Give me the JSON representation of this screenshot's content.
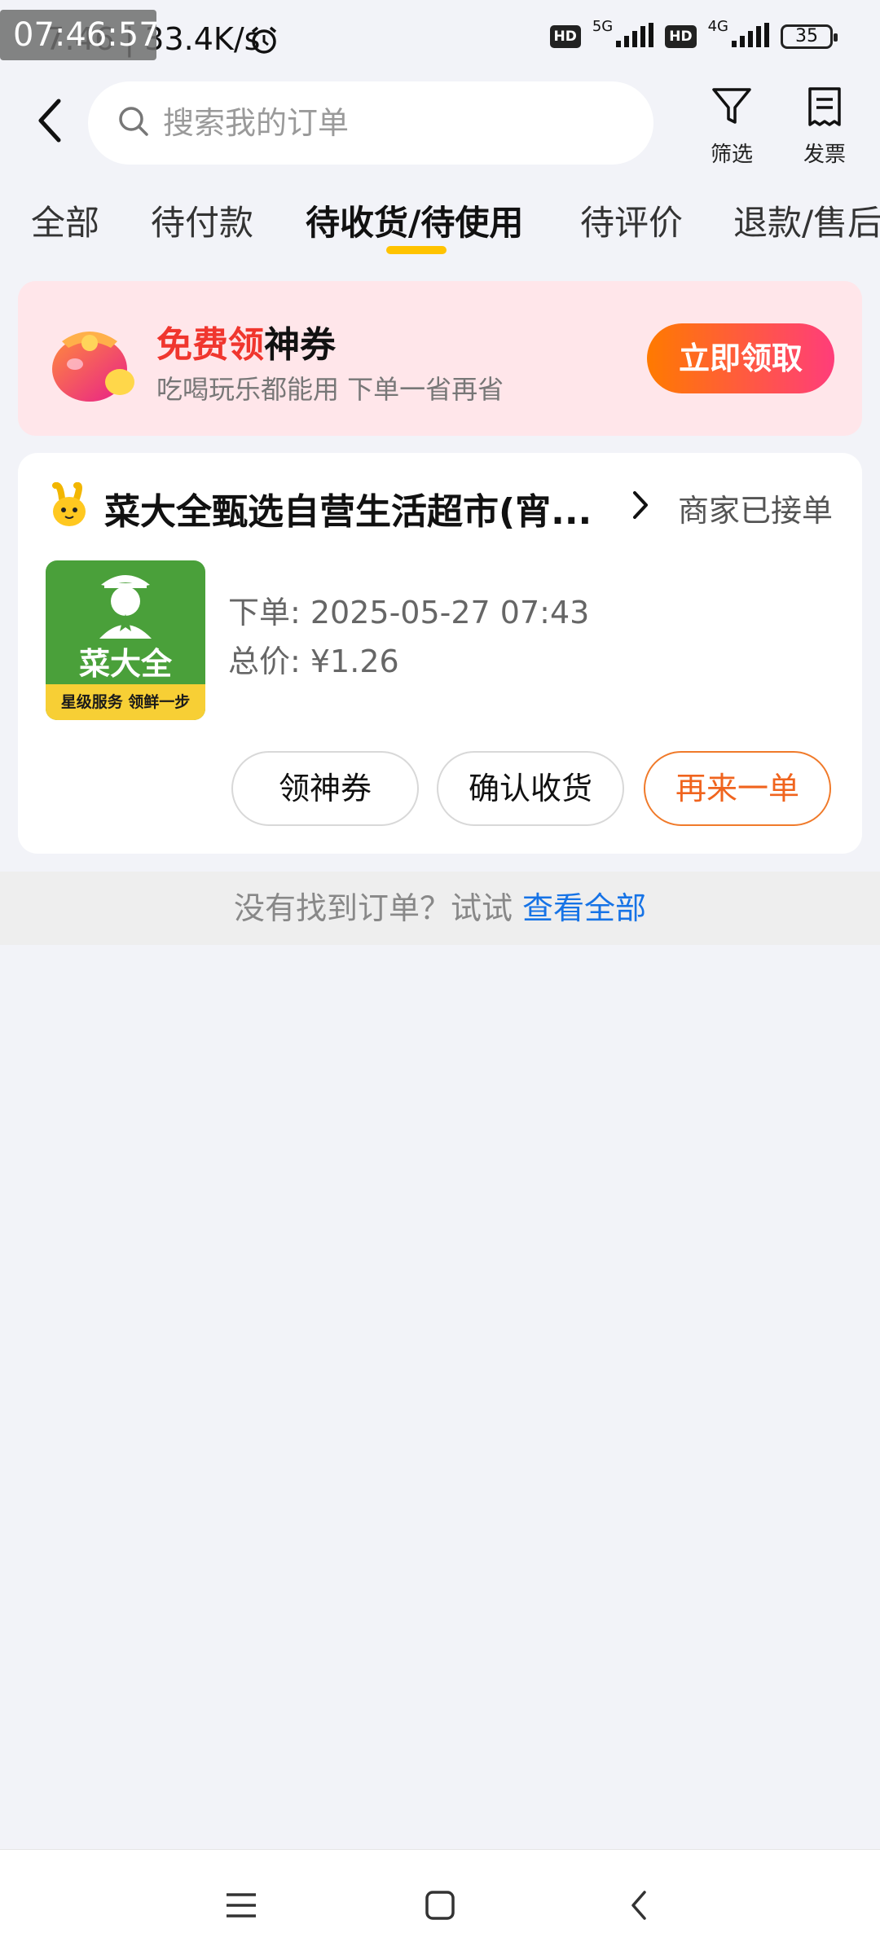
{
  "status_bar": {
    "recording_time": "07:46:57",
    "time_speed": "7:46 | 33.4K/s",
    "sim1_hd": "HD",
    "sim1_network": "5G",
    "sim2_hd": "HD",
    "sim2_network": "4G",
    "battery": "35"
  },
  "header": {
    "search_placeholder": "搜索我的订单",
    "filter_label": "筛选",
    "invoice_label": "发票"
  },
  "tabs": [
    {
      "label": "全部"
    },
    {
      "label": "待付款"
    },
    {
      "label": "待收货/待使用",
      "active": true
    },
    {
      "label": "待评价"
    },
    {
      "label": "退款/售后"
    }
  ],
  "promo": {
    "title_highlight": "免费领",
    "title_rest": "神券",
    "subtitle": "吃喝玩乐都能用 下单一省再省",
    "button": "立即领取"
  },
  "order": {
    "shop_name": "菜大全甄选自营生活超市(宵...",
    "status": "商家已接单",
    "logo_name": "菜大全",
    "logo_slogan": "星级服务 领鲜一步",
    "order_time": "下单: 2025-05-27 07:43",
    "total": "总价: ¥1.26",
    "buttons": {
      "coupon": "领神券",
      "confirm": "确认收货",
      "reorder": "再来一单"
    }
  },
  "hint": {
    "text": "没有找到订单？试试 ",
    "link": "查看全部"
  },
  "colors": {
    "accent_yellow": "#ffc300",
    "promo_red": "#f0362e",
    "reorder_orange": "#f0641e",
    "link_blue": "#1673e6"
  }
}
